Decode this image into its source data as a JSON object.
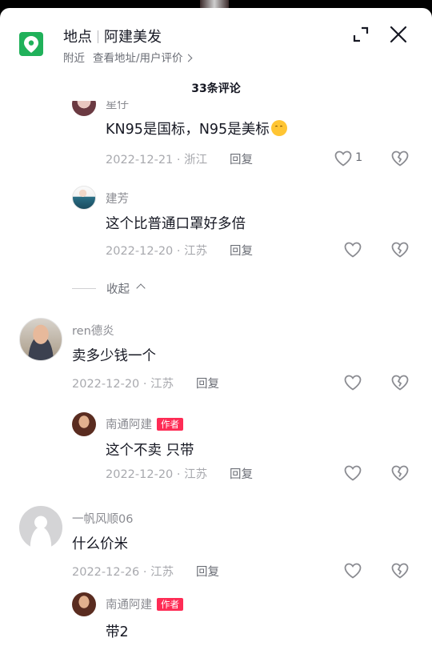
{
  "header": {
    "place_label": "地点",
    "place_name": "阿建美发",
    "nearby": "附近",
    "detail_link": "查看地址/用户评价"
  },
  "comments_title": "33条评论",
  "collapse_label": "收起",
  "reply_label": "回复",
  "author_badge": "作者",
  "comments": [
    {
      "user": "星仔",
      "text": "KN95是国标，N95是美标",
      "emoji": "smirk-emoji",
      "date": "2022-12-21 · 浙江",
      "likes": "1"
    },
    {
      "user": "建芳",
      "text": "这个比普通口罩好多倍",
      "date": "2022-12-20 · 江苏"
    },
    {
      "user": "ren德炎",
      "text": "卖多少钱一个",
      "date": "2022-12-20 · 江苏"
    },
    {
      "user": "南通阿建",
      "text": "这个不卖 只带",
      "date": "2022-12-20 · 江苏"
    },
    {
      "user": "一帆风顺06",
      "text": "什么价米",
      "date": "2022-12-26 · 江苏"
    },
    {
      "user": "南通阿建",
      "text": "带2"
    }
  ],
  "colors": {
    "location_green": "#20b15a",
    "author_badge": "#fe2c55",
    "meta_gray": "#a8a9ae"
  },
  "icons": [
    "location-pin-icon",
    "expand-icon",
    "close-icon",
    "chevron-right-icon",
    "heart-icon",
    "broken-heart-icon",
    "chevron-up-icon"
  ]
}
